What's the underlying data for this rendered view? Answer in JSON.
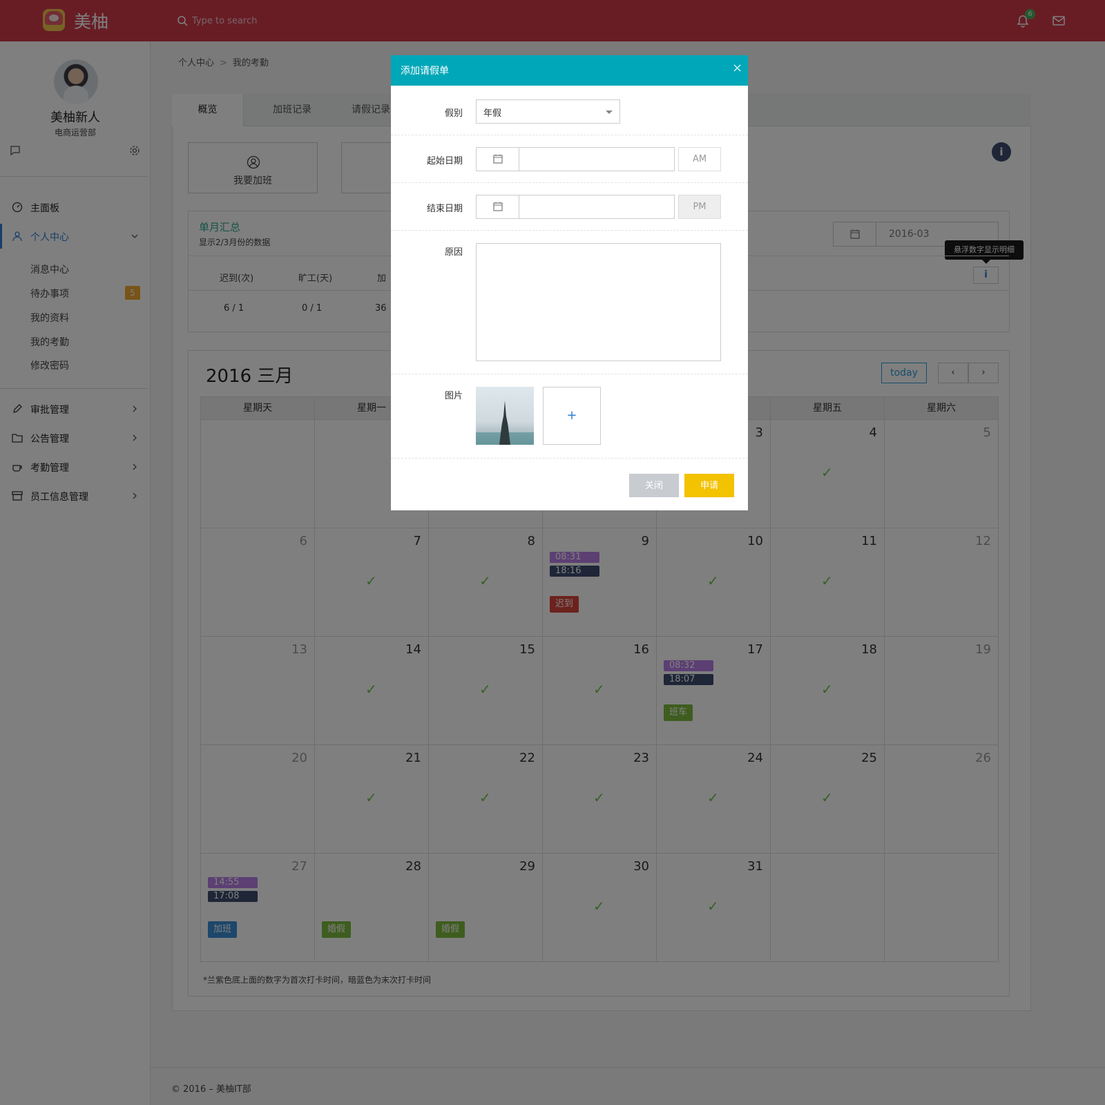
{
  "topbar": {
    "brand": "美柚",
    "search_placeholder": "Type to search",
    "notifications_count": "6"
  },
  "sidebar": {
    "user_name": "美柚新人",
    "user_dept": "电商运营部",
    "nav": [
      {
        "label": "主面板",
        "icon": "dashboard-icon"
      },
      {
        "label": "个人中心",
        "icon": "user-icon",
        "active": true
      },
      {
        "label": "审批管理",
        "icon": "pencil-icon"
      },
      {
        "label": "公告管理",
        "icon": "folder-icon"
      },
      {
        "label": "考勤管理",
        "icon": "coffee-cup-icon"
      },
      {
        "label": "员工信息管理",
        "icon": "archive-icon"
      }
    ],
    "subitems": [
      {
        "label": "消息中心"
      },
      {
        "label": "待办事项",
        "badge": "5"
      },
      {
        "label": "我的资料"
      },
      {
        "label": "我的考勤"
      },
      {
        "label": "修改密码"
      }
    ]
  },
  "breadcrumb": {
    "root": "个人中心",
    "separator": ">",
    "current": "我的考勤"
  },
  "tabs": [
    "概览",
    "加班记录",
    "请假记录"
  ],
  "quick_actions": {
    "overtime": "我要加班",
    "leave_partial": "我"
  },
  "summary": {
    "title": "单月汇总",
    "subtitle": "显示2/3月份的数据",
    "month_value": "2016-03",
    "tooltip": "悬浮数字显示明细",
    "info_button": "i",
    "columns": [
      {
        "header": "迟到(次)",
        "value": "6 / 1"
      },
      {
        "header": "旷工(天)",
        "value": "0 / 1"
      },
      {
        "header": "加",
        "value": "36"
      }
    ]
  },
  "calendar": {
    "title": "2016 三月",
    "today_label": "today",
    "prev": "‹",
    "next": "›",
    "weekdays": [
      "星期天",
      "星期一",
      "",
      "",
      "",
      "星期五",
      "星期六"
    ],
    "weeks": [
      [
        {
          "day": "",
          "w": true
        },
        {
          "day": ""
        },
        {
          "day": ""
        },
        {
          "day": ""
        },
        {
          "day": "3"
        },
        {
          "day": "4",
          "check": true
        },
        {
          "day": "5",
          "w": true
        }
      ],
      [
        {
          "day": "6",
          "w": true
        },
        {
          "day": "7",
          "check": true
        },
        {
          "day": "8",
          "check": true
        },
        {
          "day": "9",
          "t1": "08:31",
          "t2": "18:16",
          "tag": "迟到",
          "tagColor": "#d9453b"
        },
        {
          "day": "10",
          "check": true
        },
        {
          "day": "11",
          "check": true
        },
        {
          "day": "12",
          "w": true
        }
      ],
      [
        {
          "day": "13",
          "w": true
        },
        {
          "day": "14",
          "check": true
        },
        {
          "day": "15",
          "check": true
        },
        {
          "day": "16",
          "check": true
        },
        {
          "day": "17",
          "t1": "08:32",
          "t2": "18:07",
          "tag": "班车",
          "tagColor": "#7dbb3c"
        },
        {
          "day": "18",
          "check": true
        },
        {
          "day": "19",
          "w": true
        }
      ],
      [
        {
          "day": "20",
          "w": true
        },
        {
          "day": "21",
          "check": true
        },
        {
          "day": "22",
          "check": true
        },
        {
          "day": "23",
          "check": true
        },
        {
          "day": "24",
          "check": true
        },
        {
          "day": "25",
          "check": true
        },
        {
          "day": "26",
          "w": true
        }
      ],
      [
        {
          "day": "27",
          "w": true,
          "t1": "14:55",
          "t2": "17:08",
          "tag": "加班",
          "tagColor": "#3a8fd6"
        },
        {
          "day": "28",
          "tag": "婚假",
          "tagColor": "#7dbb3c"
        },
        {
          "day": "29",
          "tag": "婚假",
          "tagColor": "#7dbb3c"
        },
        {
          "day": "30",
          "check": true
        },
        {
          "day": "31",
          "check": true
        },
        {
          "day": ""
        },
        {
          "day": "",
          "w": true
        }
      ]
    ],
    "note": "*兰紫色底上面的数字为首次打卡时间，暗蓝色为末次打卡时间"
  },
  "footer": "© 2016 – 美柚IT部",
  "modal": {
    "title": "添加请假单",
    "close_x": "×",
    "leave_type_label": "假别",
    "leave_type_value": "年假",
    "start_label": "起始日期",
    "start_ampm": "AM",
    "end_label": "结束日期",
    "end_ampm": "PM",
    "reason_label": "原因",
    "image_label": "图片",
    "add_image": "+",
    "close_button": "关闭",
    "apply_button": "申请"
  },
  "colors": {
    "topbar": "#d03a4b",
    "modal_header": "#00a7b8",
    "apply": "#f3c200",
    "check": "#6cc24a"
  }
}
